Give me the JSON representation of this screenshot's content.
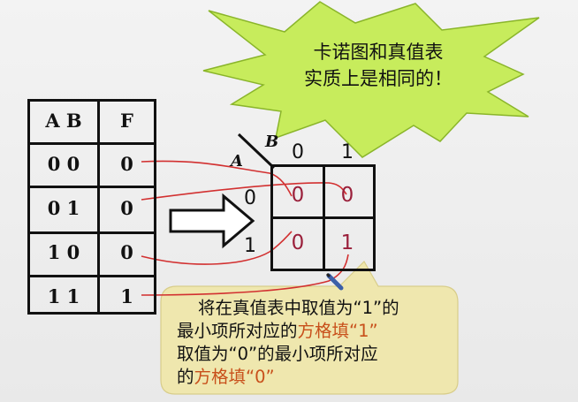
{
  "truth_table": {
    "header": {
      "ab": "A B",
      "f": "F"
    },
    "rows": [
      {
        "ab": "0 0",
        "f": "0"
      },
      {
        "ab": "0 1",
        "f": "0"
      },
      {
        "ab": "1 0",
        "f": "0"
      },
      {
        "ab": "1 1",
        "f": "1"
      }
    ]
  },
  "kmap": {
    "var_a": "A",
    "var_b": "B",
    "col_labels": [
      "0",
      "1"
    ],
    "row_labels": [
      "0",
      "1"
    ],
    "cells": [
      [
        "0",
        "0"
      ],
      [
        "0",
        "1"
      ]
    ]
  },
  "star_note": {
    "line1": "卡诺图和真值表",
    "line2": "实质上是相同的！"
  },
  "callout": {
    "line1": "将在真值表中取值为“1”的",
    "line2_a": "最小项所对应的",
    "line2_b": "方格填“1”",
    "line3": "取值为“0”的最小项所对应",
    "line4_a": "的",
    "line4_b": "方格填“0”"
  },
  "colors": {
    "star_fill": "#c7ec5c",
    "star_stroke": "#8ab52a",
    "callout_fill": "#efe7ae",
    "connector": "#d23030",
    "kmap_value": "#9a1f3a",
    "highlight_text": "#c8501b",
    "arrow_fill": "#ffffff",
    "arrow_stroke": "#111111"
  }
}
